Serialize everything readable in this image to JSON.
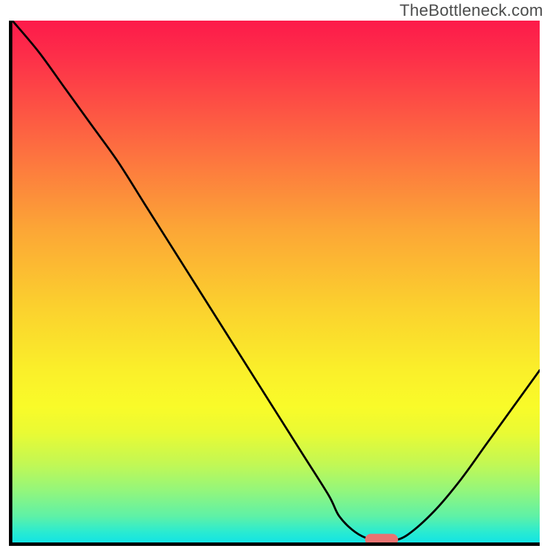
{
  "watermark_text": "TheBottleneck.com",
  "chart_data": {
    "type": "line",
    "title": "",
    "xlabel": "",
    "ylabel": "",
    "xlim": [
      0,
      100
    ],
    "ylim": [
      0,
      100
    ],
    "x": [
      0,
      5,
      10,
      15,
      20,
      25,
      30,
      35,
      40,
      45,
      50,
      55,
      60,
      62,
      65,
      68,
      70,
      72,
      75,
      80,
      85,
      90,
      95,
      100
    ],
    "values": [
      100,
      94,
      87,
      80,
      73,
      65,
      57,
      49,
      41,
      33,
      25,
      17,
      9,
      5,
      2,
      0.5,
      0.3,
      0.3,
      1.5,
      6,
      12,
      19,
      26,
      33
    ],
    "marker": {
      "x": 70,
      "y": 0.5
    },
    "background_gradient": {
      "type": "vertical",
      "stops": [
        {
          "pos": 0,
          "color": "#fd1a4a"
        },
        {
          "pos": 25,
          "color": "#fd7040"
        },
        {
          "pos": 55,
          "color": "#fbd12e"
        },
        {
          "pos": 74,
          "color": "#f9fb29"
        },
        {
          "pos": 90,
          "color": "#94f67b"
        },
        {
          "pos": 100,
          "color": "#13e4e4"
        }
      ]
    }
  }
}
